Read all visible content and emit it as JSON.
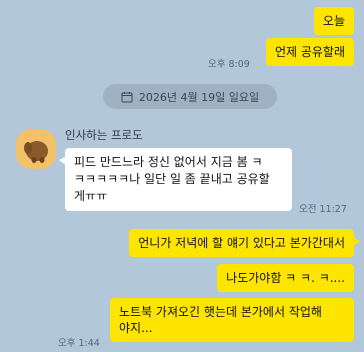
{
  "messages_mine_top": [
    {
      "text": "오늘"
    },
    {
      "text": "언제 공유할래"
    }
  ],
  "time_top": "오후 8:09",
  "date_divider": "2026년 4월 19일 일요일",
  "sender_name": "인사하는 프로도",
  "incoming": {
    "lines": [
      "피드 만드느라 정신 없어서 지금 봄 ㅋ",
      "ㅋㅋㅋㅋㅋ나 일단 일 좀 끝내고 공유할",
      "게ㅠㅠ"
    ],
    "time": "오전 11:27"
  },
  "messages_mine_bottom": [
    {
      "text": "언니가 저녁에 할 얘기 있다고 본가간대서"
    },
    {
      "text": "나도가야함 ㅋ ㅋ. ㅋ...."
    },
    {
      "lines": [
        "노트북 가져오긴 햇는데 본가에서 작업해",
        "야지..."
      ]
    }
  ],
  "time_bottom": "오후 1:44",
  "colors": {
    "background": "#b2c7d9",
    "my_bubble": "#fee500",
    "their_bubble": "#ffffff"
  },
  "icons": {
    "date": "calendar-icon",
    "avatar": "frodo-character-avatar"
  }
}
